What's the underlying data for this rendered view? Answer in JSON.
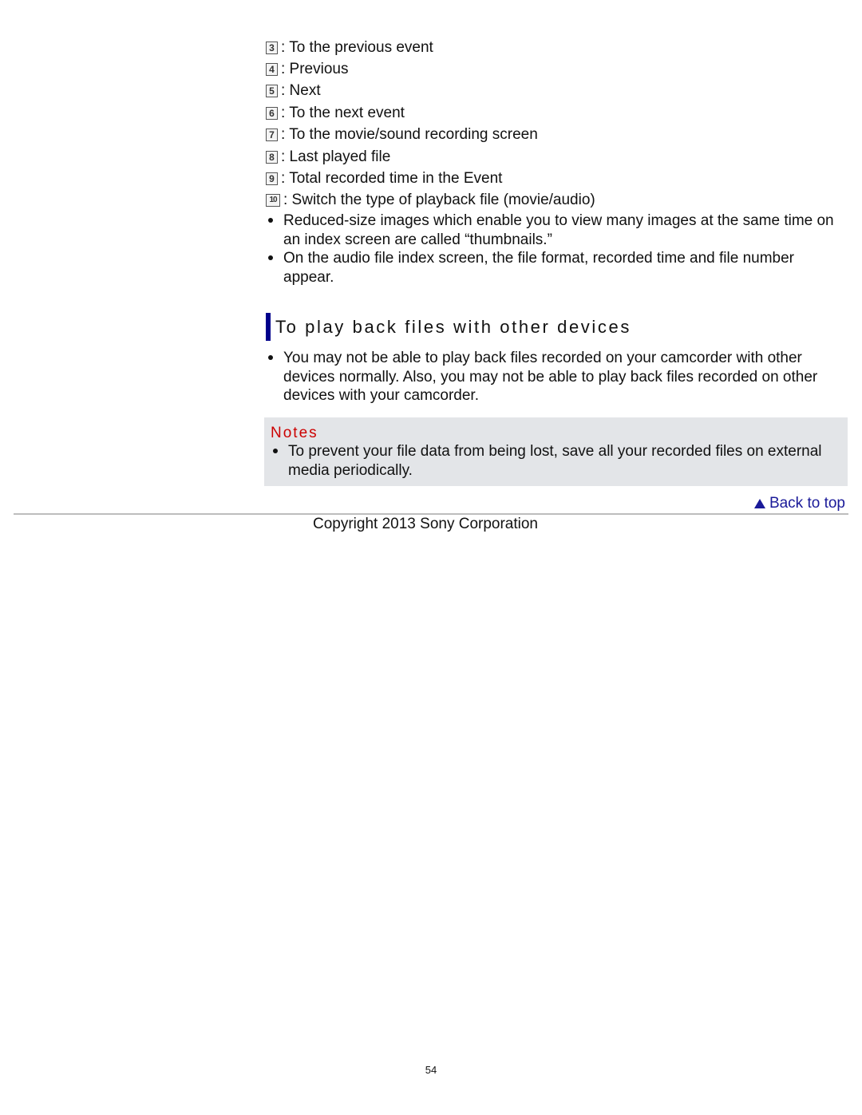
{
  "legend": [
    {
      "num": "3",
      "label": ": To the previous event"
    },
    {
      "num": "4",
      "label": ": Previous"
    },
    {
      "num": "5",
      "label": ": Next"
    },
    {
      "num": "6",
      "label": ": To the next event"
    },
    {
      "num": "7",
      "label": ": To the movie/sound recording screen"
    },
    {
      "num": "8",
      "label": ": Last played file"
    },
    {
      "num": "9",
      "label": ": Total recorded time in the Event"
    },
    {
      "num": "10",
      "label": ": Switch the type of playback file (movie/audio)"
    }
  ],
  "bullets": [
    "Reduced-size images which enable you to view many images at the same time on an index screen are called “thumbnails.”",
    "On the audio file index screen, the file format, recorded time and file number appear."
  ],
  "section": {
    "heading": "To play back files with other devices",
    "bullets": [
      "You may not be able to play back files recorded on your camcorder with other devices normally. Also, you may not be able to play back files recorded on other devices with your camcorder."
    ]
  },
  "notes": {
    "title": "Notes",
    "items": [
      "To prevent your file data from being lost, save all your recorded files on external media periodically."
    ]
  },
  "back_to_top": "Back to top",
  "copyright": "Copyright 2013 Sony Corporation",
  "page_number": "54",
  "colors": {
    "heading_bar": "#00008b",
    "notes_title": "#cc0000",
    "link": "#1a1a99",
    "notes_bg": "#e3e5e8"
  }
}
